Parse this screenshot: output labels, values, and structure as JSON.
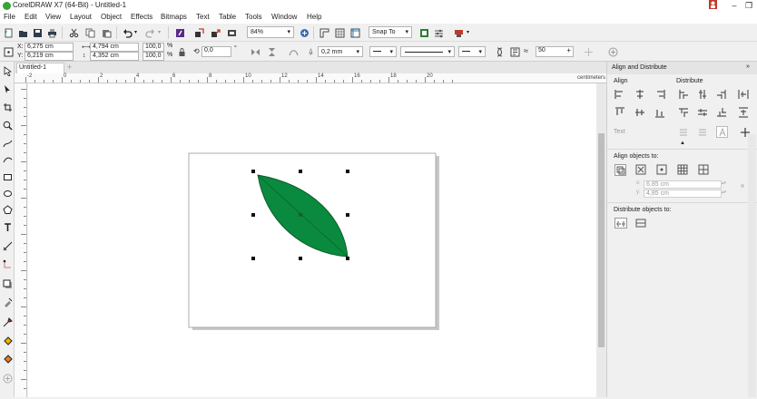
{
  "window": {
    "title": "CorelDRAW X7 (64-Bit) - Untitled-1"
  },
  "menu": [
    "File",
    "Edit",
    "View",
    "Layout",
    "Object",
    "Effects",
    "Bitmaps",
    "Text",
    "Table",
    "Tools",
    "Window",
    "Help"
  ],
  "toolbar": {
    "zoom": "84%",
    "snap": "Snap To"
  },
  "props": {
    "x": "6,275 cm",
    "y": "6,219 cm",
    "w": "4,794 cm",
    "h": "4,352 cm",
    "sx": "100,0",
    "sy": "100,0",
    "pct": "%",
    "angle": "0,0",
    "outline": "0,2 mm",
    "smooth": "50"
  },
  "doc": {
    "tab": "Untitled-1"
  },
  "ruler": {
    "units": "centimeters",
    "labels": [
      "-2",
      "0",
      "2",
      "4",
      "6",
      "8",
      "10",
      "12",
      "14",
      "16",
      "18",
      "20"
    ]
  },
  "docker": {
    "title": "Align and Distribute",
    "align_label": "Align",
    "distribute_label": "Distribute",
    "text_label": "Text",
    "align_to_label": "Align objects to:",
    "align_x": "6,85 cm",
    "align_y": "4,85 cm",
    "distribute_to_label": "Distribute objects to:"
  },
  "colors": {
    "leaf": "#0a8a3e",
    "leaf_stroke": "#0b5a2a",
    "accent": "#3aa23a"
  }
}
